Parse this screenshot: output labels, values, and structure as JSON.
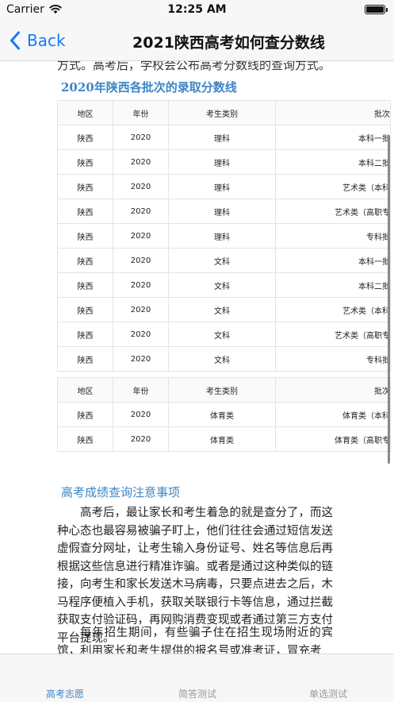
{
  "status_bar": {
    "carrier": "Carrier",
    "time": "12:25 AM"
  },
  "nav": {
    "back_label": "Back",
    "title": "2021陕西高考如何查分数线"
  },
  "article": {
    "clipped_line": "方式。高考后，学校会公布高考分数线的查询方式。",
    "section1_title": "2020年陕西各批次的录取分数线",
    "table_headers": [
      "地区",
      "年份",
      "考生类别",
      "批次"
    ],
    "table1_rows": [
      [
        "陕西",
        "2020",
        "理科",
        "本科一批"
      ],
      [
        "陕西",
        "2020",
        "理科",
        "本科二批"
      ],
      [
        "陕西",
        "2020",
        "理科",
        "艺术类（本科"
      ],
      [
        "陕西",
        "2020",
        "理科",
        "艺术类（高职专"
      ],
      [
        "陕西",
        "2020",
        "理科",
        "专科批"
      ],
      [
        "陕西",
        "2020",
        "文科",
        "本科一批"
      ],
      [
        "陕西",
        "2020",
        "文科",
        "本科二批"
      ],
      [
        "陕西",
        "2020",
        "文科",
        "艺术类（本科"
      ],
      [
        "陕西",
        "2020",
        "文科",
        "艺术类（高职专"
      ],
      [
        "陕西",
        "2020",
        "文科",
        "专科批"
      ]
    ],
    "table2_rows": [
      [
        "陕西",
        "2020",
        "体育类",
        "体育类（本科"
      ],
      [
        "陕西",
        "2020",
        "体育类",
        "体育类（高职专"
      ]
    ],
    "section2_title": "高考成绩查询注意事项",
    "paragraph1": "高考后，最让家长和考生着急的就是查分了，而这种心态也最容易被骗子盯上，他们往往会通过短信发送虚假查分网址，让考生输入身份证号、姓名等信息后再根据这些信息进行精准诈骗。或者是通过这种类似的链接，向考生和家长发送木马病毒，只要点进去之后，木马程序便植入手机，获取关联银行卡等信息，通过拦截获取支付验证码，再网购消费变现或者通过第三方支付平台提现。",
    "paragraph2": "每年招生期间，有些骗子住在招生现场附近的宾馆，利用家长和考生提供的报名号或准考证，冒充考"
  },
  "tabs": [
    "高考志愿",
    "简答测试",
    "单选测试"
  ],
  "colors": {
    "accent": "#1479fb",
    "section": "#3d85c6"
  }
}
